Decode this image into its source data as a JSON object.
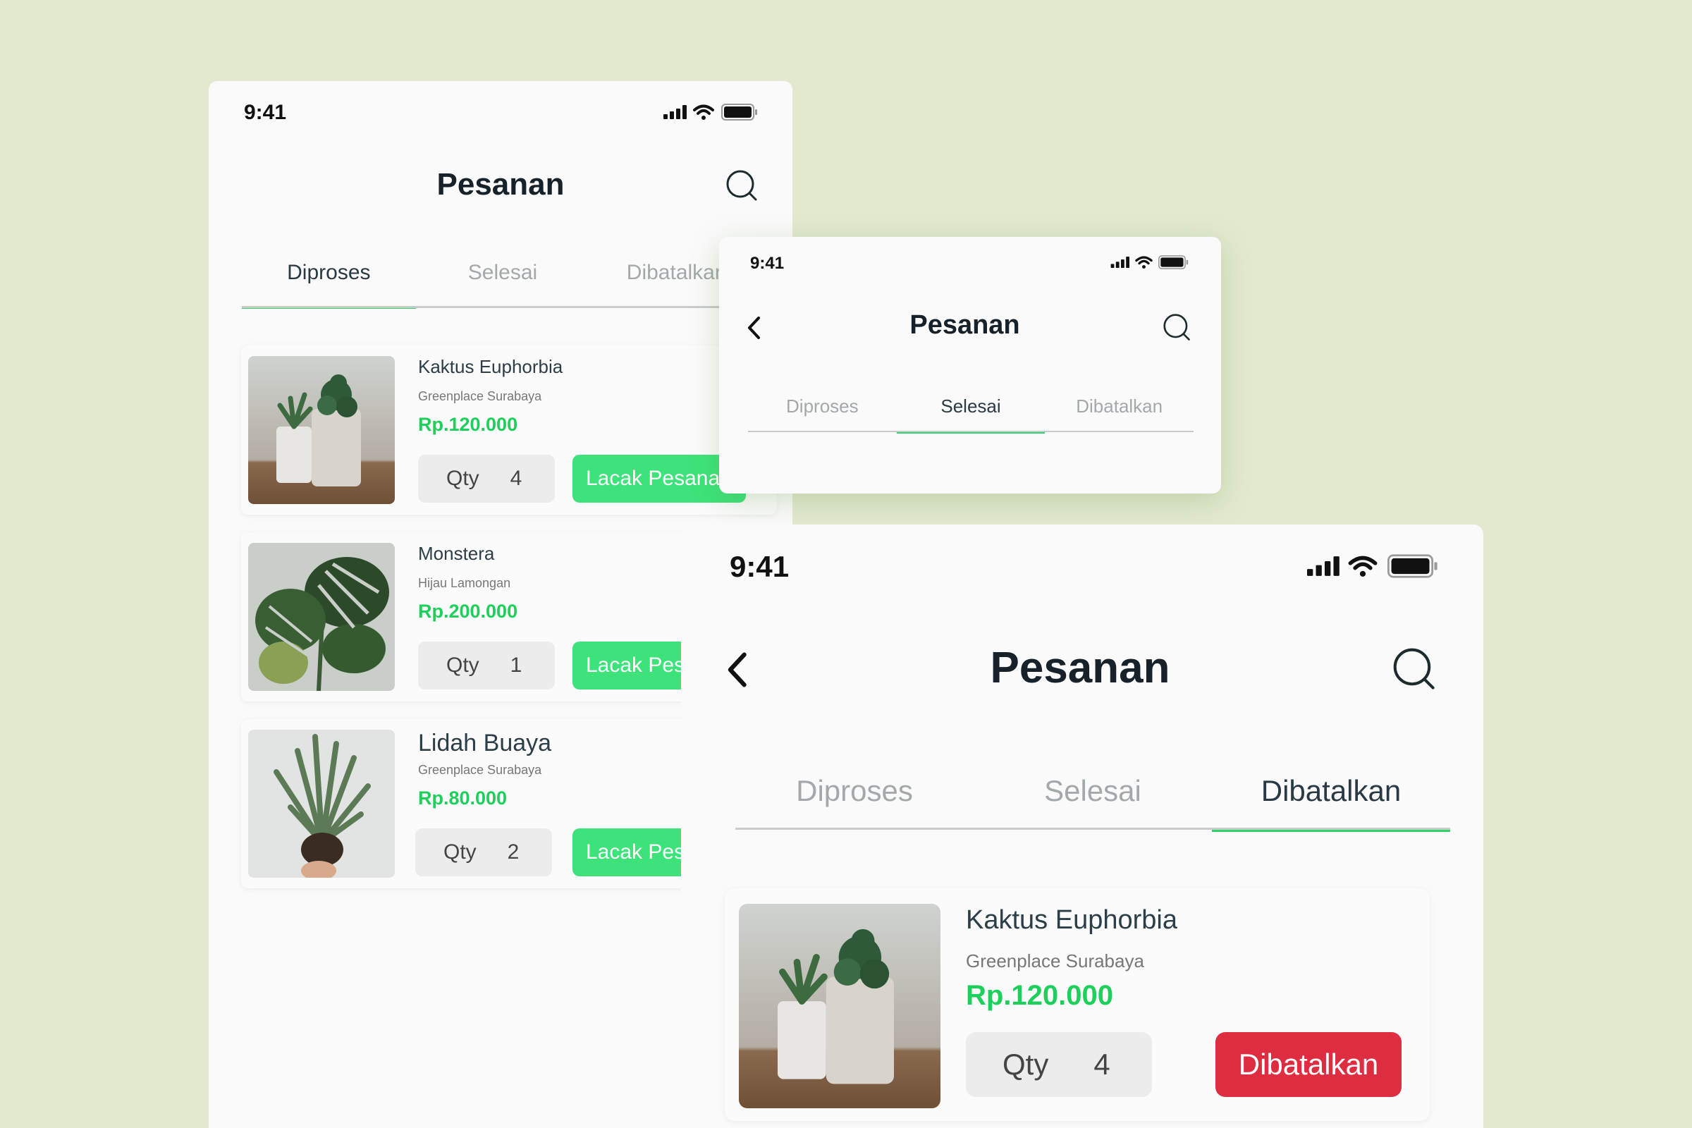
{
  "colors": {
    "background": "#e2e9cf",
    "accent_green": "#2fd46a",
    "price_green": "#1fcf5c",
    "button_green": "#3de37a",
    "button_red": "#de2d40"
  },
  "icons": {
    "signal": "cellular-signal-icon",
    "wifi": "wifi-icon",
    "battery": "battery-icon",
    "search": "search-icon",
    "back": "chevron-left-icon"
  },
  "screen1": {
    "status_time": "9:41",
    "title": "Pesanan",
    "tabs": [
      {
        "label": "Diproses",
        "active": true
      },
      {
        "label": "Selesai",
        "active": false
      },
      {
        "label": "Dibatalkan",
        "active": false
      }
    ],
    "orders": [
      {
        "name": "Kaktus Euphorbia",
        "shop": "Greenplace Surabaya",
        "price": "Rp.120.000",
        "qty_label": "Qty",
        "qty": "4",
        "action": "Lacak Pesanan"
      },
      {
        "name": "Monstera",
        "shop": "Hijau Lamongan",
        "price": "Rp.200.000",
        "qty_label": "Qty",
        "qty": "1",
        "action": "Lacak Pesanan"
      },
      {
        "name": "Lidah Buaya",
        "shop": "Greenplace Surabaya",
        "price": "Rp.80.000",
        "qty_label": "Qty",
        "qty": "2",
        "action": "Lacak Pesanan"
      }
    ]
  },
  "screen2": {
    "status_time": "9:41",
    "title": "Pesanan",
    "tabs": [
      {
        "label": "Diproses",
        "active": false
      },
      {
        "label": "Selesai",
        "active": true
      },
      {
        "label": "Dibatalkan",
        "active": false
      }
    ]
  },
  "screen3": {
    "status_time": "9:41",
    "title": "Pesanan",
    "tabs": [
      {
        "label": "Diproses",
        "active": false
      },
      {
        "label": "Selesai",
        "active": false
      },
      {
        "label": "Dibatalkan",
        "active": true
      }
    ],
    "orders": [
      {
        "name": "Kaktus Euphorbia",
        "shop": "Greenplace Surabaya",
        "price": "Rp.120.000",
        "qty_label": "Qty",
        "qty": "4",
        "action": "Dibatalkan"
      }
    ]
  }
}
